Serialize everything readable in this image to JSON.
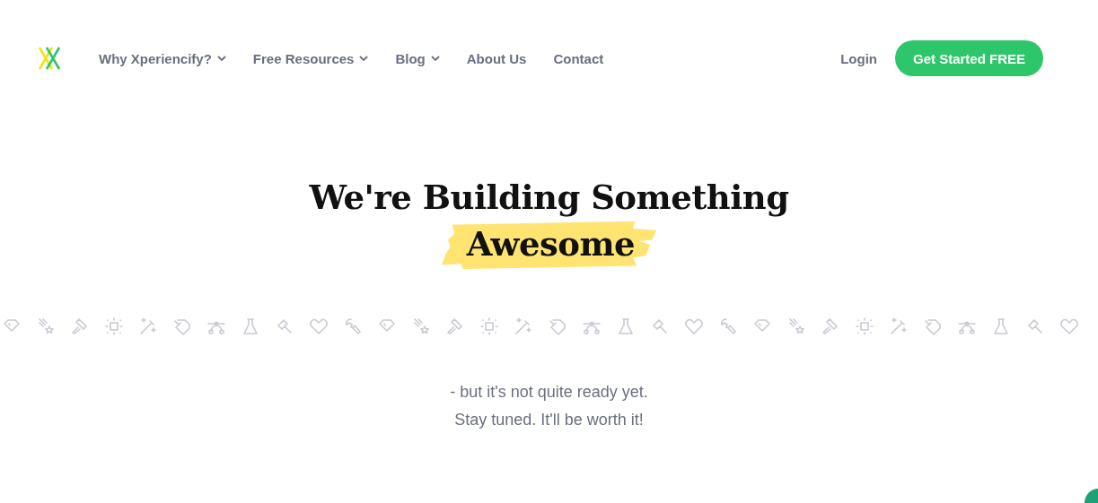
{
  "nav": {
    "items": [
      {
        "label": "Why Xperiencify?",
        "dropdown": true
      },
      {
        "label": "Free Resources",
        "dropdown": true
      },
      {
        "label": "Blog",
        "dropdown": true
      },
      {
        "label": "About Us",
        "dropdown": false
      },
      {
        "label": "Contact",
        "dropdown": false
      }
    ],
    "login": "Login",
    "cta": "Get Started FREE"
  },
  "hero": {
    "title_line": "We're Building Something",
    "highlight": "Awesome"
  },
  "message": [
    "- but it's not quite ready yet.",
    "Stay tuned. It'll be worth it!"
  ]
}
